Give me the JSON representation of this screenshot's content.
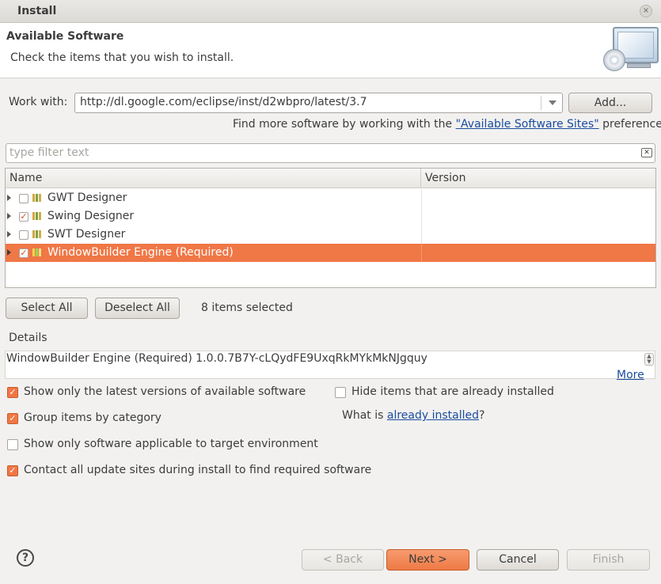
{
  "window": {
    "title": "Install",
    "close_glyph": "×"
  },
  "header": {
    "title": "Available Software",
    "subtitle": "Check the items that you wish to install.",
    "icon": "monitor-cd-icon"
  },
  "work_with": {
    "label": "Work with:",
    "value": "http://dl.google.com/eclipse/inst/d2wbpro/latest/3.7",
    "add_button": "Add...",
    "hint_prefix": "Find more software by working with the ",
    "hint_link": "\"Available Software Sites\"",
    "hint_suffix": " preferences."
  },
  "filter": {
    "placeholder": "type filter text",
    "clear_glyph": "✕"
  },
  "table": {
    "columns": [
      "Name",
      "Version"
    ],
    "rows": [
      {
        "name": "GWT Designer",
        "version": "",
        "checked": false,
        "selected": false
      },
      {
        "name": "Swing Designer",
        "version": "",
        "checked": true,
        "selected": false
      },
      {
        "name": "SWT Designer",
        "version": "",
        "checked": false,
        "selected": false
      },
      {
        "name": "WindowBuilder Engine (Required)",
        "version": "",
        "checked": true,
        "selected": true
      }
    ]
  },
  "selection": {
    "select_all": "Select All",
    "deselect_all": "Deselect All",
    "status": "8 items selected"
  },
  "details": {
    "label": "Details",
    "text": "WindowBuilder Engine (Required) 1.0.0.7B7Y-cLQydFE9UxqRkMYkMkNJgquy",
    "more_link": "More"
  },
  "options": {
    "latest_versions": {
      "label": "Show only the latest versions of available software",
      "checked": true
    },
    "group_by_category": {
      "label": "Group items by category",
      "checked": true
    },
    "target_env": {
      "label": "Show only software applicable to target environment",
      "checked": false
    },
    "contact_sites": {
      "label": "Contact all update sites during install to find required software",
      "checked": true
    },
    "hide_installed": {
      "label": "Hide items that are already installed",
      "checked": false
    },
    "what_is_prefix": "What is ",
    "what_is_link": "already installed",
    "what_is_suffix": "?"
  },
  "footer": {
    "help_glyph": "?",
    "back": "< Back",
    "next": "Next >",
    "cancel": "Cancel",
    "finish": "Finish"
  },
  "colors": {
    "accent": "#f07746",
    "link": "#1a4c9e",
    "dialog_bg": "#f2f1f0"
  }
}
